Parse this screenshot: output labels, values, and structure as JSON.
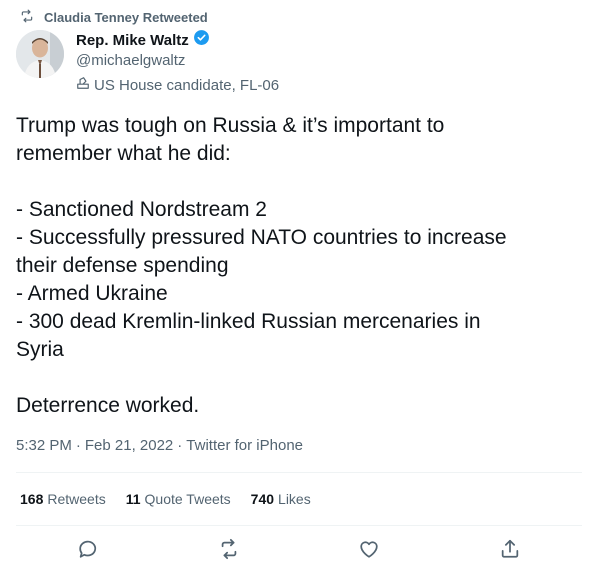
{
  "retweet": {
    "label": "Claudia Tenney Retweeted"
  },
  "author": {
    "name": "Rep. Mike Waltz",
    "handle": "@michaelgwaltz",
    "label": "US House candidate, FL-06"
  },
  "tweet": {
    "text": "Trump was tough on Russia & it’s important to\nremember what he did:\n\n- Sanctioned Nordstream 2\n- Successfully pressured NATO countries to increase\ntheir defense spending\n- Armed Ukraine\n- 300 dead Kremlin-linked Russian mercenaries in\nSyria\n\nDeterrence worked.",
    "time": "5:32 PM",
    "sep1": "·",
    "date": "Feb 21, 2022",
    "sep2": "·",
    "source": "Twitter for iPhone"
  },
  "stats": {
    "retweets": {
      "num": "168",
      "label": "Retweets"
    },
    "quotes": {
      "num": "11",
      "label": "Quote Tweets"
    },
    "likes": {
      "num": "740",
      "label": "Likes"
    }
  },
  "icons": {
    "retweet_indicator": "retweet-icon",
    "verified": "verified-badge-icon",
    "label": "ballot-box-icon",
    "reply": "reply-icon",
    "retweet": "retweet-icon",
    "like": "heart-icon",
    "share": "share-icon"
  },
  "colors": {
    "primary_text": "#0f1419",
    "secondary_text": "#536471",
    "verified": "#1d9bf0",
    "divider": "#eff3f4"
  }
}
